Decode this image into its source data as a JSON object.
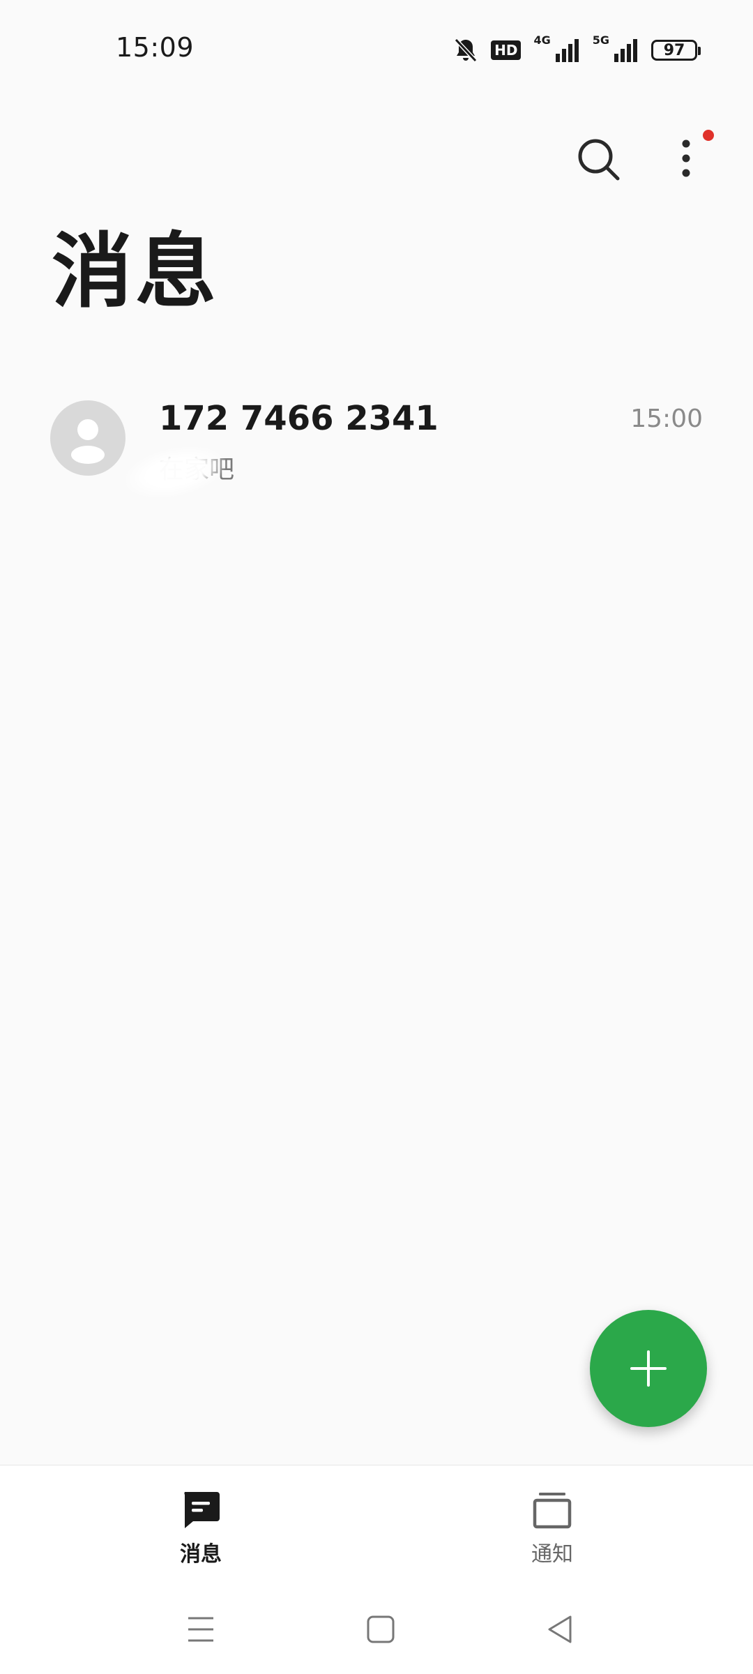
{
  "status_bar": {
    "time": "15:09",
    "hd_label": "HD",
    "net_4g": "4G",
    "net_5g": "5G",
    "battery": "97"
  },
  "header": {
    "title": "消息",
    "search_icon": "search-icon",
    "more_icon": "more-vertical-icon"
  },
  "conversations": [
    {
      "name": "172 7466 2341",
      "time": "15:00",
      "preview": "在家吧"
    }
  ],
  "fab": {
    "icon": "plus-icon",
    "color": "#2ba84a"
  },
  "bottom_nav": {
    "items": [
      {
        "label": "消息",
        "icon": "message-icon",
        "active": true
      },
      {
        "label": "通知",
        "icon": "notification-icon",
        "active": false
      }
    ]
  },
  "system_nav": {
    "menu_icon": "menu-icon",
    "home_icon": "home-icon",
    "back_icon": "back-icon"
  },
  "colors": {
    "accent": "#2ba84a",
    "badge": "#e0322b",
    "background": "#fafafa"
  }
}
